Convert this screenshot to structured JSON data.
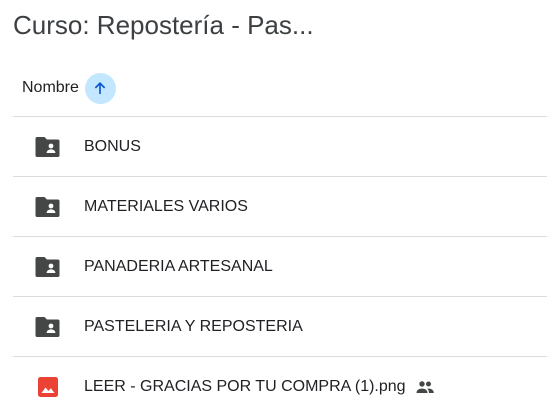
{
  "header": {
    "title": "Curso: Repostería - Pas..."
  },
  "sort": {
    "label": "Nombre",
    "direction_icon": "arrow-up-icon"
  },
  "files": [
    {
      "name": "BONUS",
      "type": "shared-folder",
      "icon": "shared-folder-icon"
    },
    {
      "name": "MATERIALES VARIOS",
      "type": "shared-folder",
      "icon": "shared-folder-icon"
    },
    {
      "name": "PANADERIA ARTESANAL",
      "type": "shared-folder",
      "icon": "shared-folder-icon"
    },
    {
      "name": "PASTELERIA Y REPOSTERIA",
      "type": "shared-folder",
      "icon": "shared-folder-icon"
    },
    {
      "name": "LEER - GRACIAS POR TU COMPRA (1).png",
      "type": "image",
      "icon": "image-file-icon",
      "shared_icon": "people-icon"
    }
  ],
  "colors": {
    "folder": "#444746",
    "image_file": "#ea4335",
    "sort_button_bg": "#c2e7ff",
    "sort_arrow": "#0b57d0",
    "divider": "#dadce0"
  }
}
